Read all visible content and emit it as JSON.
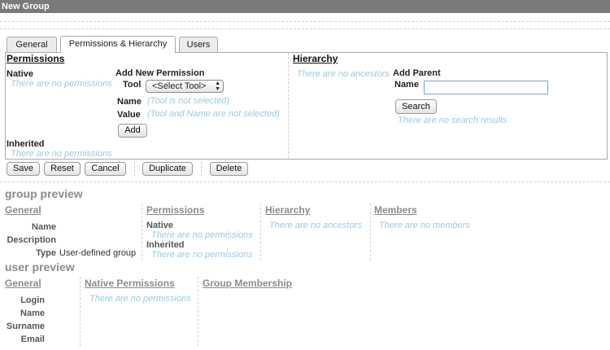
{
  "window": {
    "title": "New Group"
  },
  "tabs": [
    "General",
    "Permissions & Hierarchy",
    "Users"
  ],
  "permissions": {
    "heading": "Permissions",
    "native_label": "Native",
    "native_empty": "There are no permissions",
    "inherited_label": "Inherited",
    "inherited_empty": "There are no permissions",
    "add_new": {
      "heading": "Add New Permission",
      "tool_label": "Tool",
      "tool_selected": "<Select Tool>",
      "name_label": "Name",
      "name_hint": "(Tool is not selected)",
      "value_label": "Value",
      "value_hint": "(Tool and Name are not selected)",
      "add_button": "Add"
    }
  },
  "hierarchy": {
    "heading": "Hierarchy",
    "ancestors_empty": "There are no ancestors",
    "add_parent": {
      "heading": "Add Parent",
      "name_label": "Name",
      "name_value": "",
      "search_button": "Search",
      "no_results": "There are no search results"
    }
  },
  "actions": {
    "save": "Save",
    "reset": "Reset",
    "cancel": "Cancel",
    "duplicate": "Duplicate",
    "delete": "Delete"
  },
  "group_preview": {
    "title": "group preview",
    "general": {
      "heading": "General",
      "name_label": "Name",
      "name_value": "",
      "description_label": "Description",
      "description_value": "",
      "type_label": "Type",
      "type_value": "User-defined group"
    },
    "permissions": {
      "heading": "Permissions",
      "native_label": "Native",
      "native_empty": "There are no permissions",
      "inherited_label": "Inherited",
      "inherited_empty": "There are no permissions"
    },
    "hierarchy": {
      "heading": "Hierarchy",
      "empty": "There are no ancestors"
    },
    "members": {
      "heading": "Members",
      "empty": "There are no members"
    }
  },
  "user_preview": {
    "title": "user preview",
    "general": {
      "heading": "General",
      "login_label": "Login",
      "name_label": "Name",
      "surname_label": "Surname",
      "email_label": "Email"
    },
    "native_permissions": {
      "heading": "Native Permissions",
      "empty": "There are no permissions"
    },
    "group_membership": {
      "heading": "Group Membership"
    }
  }
}
